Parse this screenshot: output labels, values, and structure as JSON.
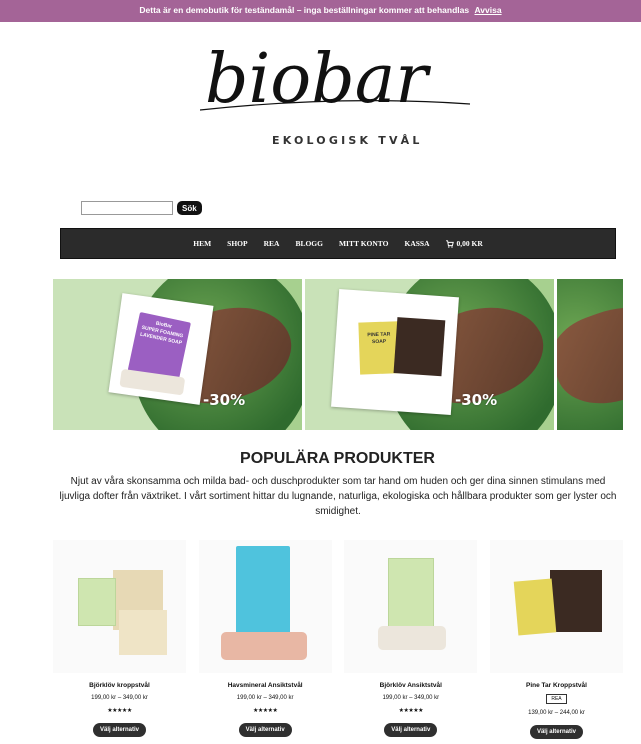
{
  "notice": {
    "text": "Detta är en demobutik för teständamål – inga beställningar kommer att behandlas",
    "dismiss": "Avvisa"
  },
  "brand": {
    "logo_text": "biobar",
    "tagline": "EKOLOGISK TVÅL"
  },
  "search": {
    "value": "",
    "button": "Sök"
  },
  "nav": {
    "items": [
      "HEM",
      "SHOP",
      "REA",
      "BLOGG",
      "MITT KONTO",
      "KASSA"
    ],
    "cart_amount": "0,00 kr"
  },
  "slider": {
    "slides": [
      {
        "discount": "-30%",
        "label_lines": [
          "BioBar",
          "SUPER FOAMING",
          "LAVENDER SOAP"
        ]
      },
      {
        "discount": "-30%",
        "label_lines": [
          "PINE TAR",
          "SOAP"
        ]
      }
    ]
  },
  "section": {
    "title": "POPULÄRA PRODUKTER",
    "intro": "Njut av våra skonsamma och milda bad- och duschprodukter som tar hand om huden och ger dina sinnen stimulans med ljuvliga dofter från växtriket. I vårt sortiment hittar du lugnande, naturliga, ekologiska och hållbara produkter som ger lyster och smidighet."
  },
  "products": [
    {
      "name": "Björklöv kroppstvål",
      "price": "199,00 kr – 349,00 kr",
      "stars": "★★★★★",
      "button": "Välj alternativ",
      "sale": ""
    },
    {
      "name": "Havsmineral Ansiktstvål",
      "price": "199,00 kr – 349,00 kr",
      "stars": "★★★★★",
      "button": "Välj alternativ",
      "sale": ""
    },
    {
      "name": "Björklöv Ansiktstvål",
      "price": "199,00 kr – 349,00 kr",
      "stars": "★★★★★",
      "button": "Välj alternativ",
      "sale": ""
    },
    {
      "name": "Pine Tar Kroppstvål",
      "price": "139,00 kr – 244,00 kr",
      "stars": "",
      "button": "Välj alternativ",
      "sale": "REA"
    }
  ],
  "colors": {
    "notice_bg": "#a46497",
    "nav_bg": "#2b2b2b",
    "button_bg": "#2f2f2f"
  }
}
